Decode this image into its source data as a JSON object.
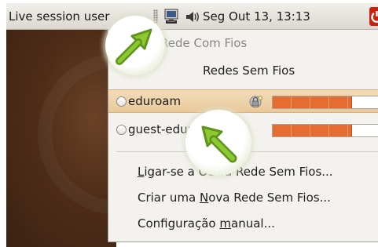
{
  "panel": {
    "session_label": "Live session user",
    "clock": "Seg Out 13, 13:13"
  },
  "menu": {
    "wired_header": "Rede Com Fios",
    "wireless_header": "Redes Sem Fios",
    "networks": [
      {
        "name": "eduroam",
        "secured": true,
        "signal": 0.75,
        "selected": false,
        "highlighted": true
      },
      {
        "name": "guest-eduroam",
        "secured": false,
        "signal": 0.75,
        "selected": false,
        "highlighted": false
      }
    ],
    "actions": {
      "connect_other_prefix": "",
      "connect_other_mnemonic": "L",
      "connect_other_rest": "igar-se a Outra Rede Sem Fios...",
      "create_new_prefix": "Criar uma ",
      "create_new_mnemonic": "N",
      "create_new_rest": "ova Rede Sem Fios...",
      "manual_prefix": "Configuração ",
      "manual_mnemonic": "m",
      "manual_rest": "anual..."
    }
  },
  "icons": {
    "network": "network-computer-icon",
    "volume": "speaker-volume-icon",
    "power": "power-icon",
    "lock": "padlock-keys-icon",
    "annotation": "green-arrow-icon"
  },
  "colors": {
    "highlight": "#e9c99a",
    "signal": "#e56d31",
    "annotation_arrow": "#7fbf2a",
    "power": "#c9210d"
  }
}
